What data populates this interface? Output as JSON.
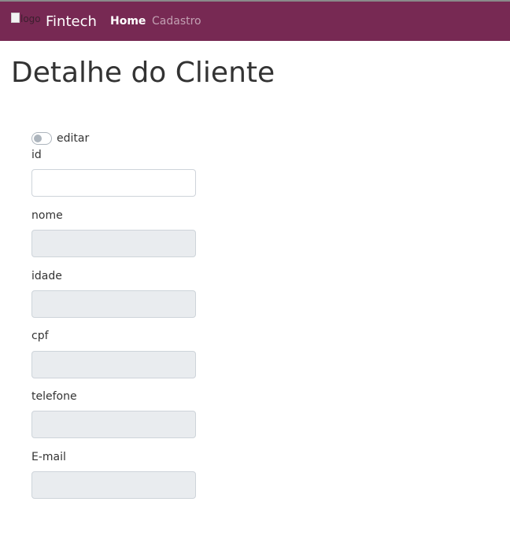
{
  "navbar": {
    "logo_alt": "logo",
    "brand": "Fintech",
    "links": [
      "Home",
      "Cadastro"
    ]
  },
  "page": {
    "title": "Detalhe do Cliente"
  },
  "form": {
    "toggle": {
      "label": "editar",
      "checked": false
    },
    "fields": [
      {
        "label": "id",
        "value": "",
        "disabled": false
      },
      {
        "label": "nome",
        "value": "",
        "disabled": true
      },
      {
        "label": "idade",
        "value": "",
        "disabled": true
      },
      {
        "label": "cpf",
        "value": "",
        "disabled": true
      },
      {
        "label": "telefone",
        "value": "",
        "disabled": true
      },
      {
        "label": "E-mail",
        "value": "",
        "disabled": true
      }
    ]
  },
  "colors": {
    "navbar_bg": "#772953",
    "disabled_input_bg": "#e9ecef",
    "input_border": "#ced4da"
  }
}
